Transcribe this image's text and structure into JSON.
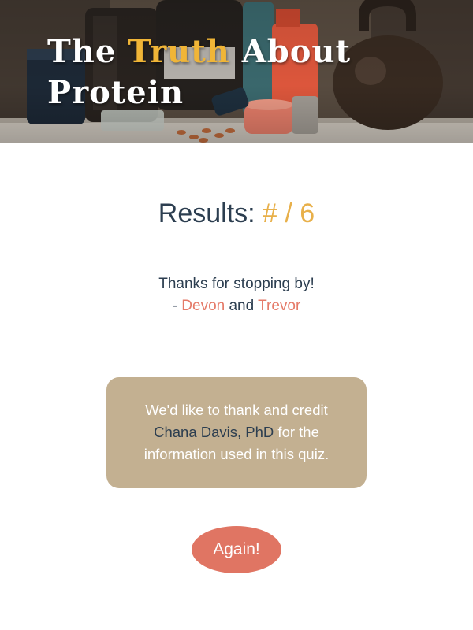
{
  "hero": {
    "title_part1": "The ",
    "title_accent": "Truth",
    "title_part2": " About Protein"
  },
  "results": {
    "label": "Results: ",
    "score": "# / 6"
  },
  "thanks": {
    "line1": "Thanks for stopping by!",
    "prefix": "- ",
    "author1": "Devon",
    "joiner": " and ",
    "author2": "Trevor"
  },
  "credit": {
    "text_before": "We'd like to thank and credit ",
    "link_label": "Chana Davis, PhD",
    "text_after": " for the information used in this quiz."
  },
  "actions": {
    "again_label": "Again!"
  },
  "colors": {
    "accent_gold": "#f0b537",
    "score_gold": "#e8b04a",
    "coral": "#e07563",
    "card_tan": "#c3b091",
    "text_navy": "#2c3e50"
  }
}
